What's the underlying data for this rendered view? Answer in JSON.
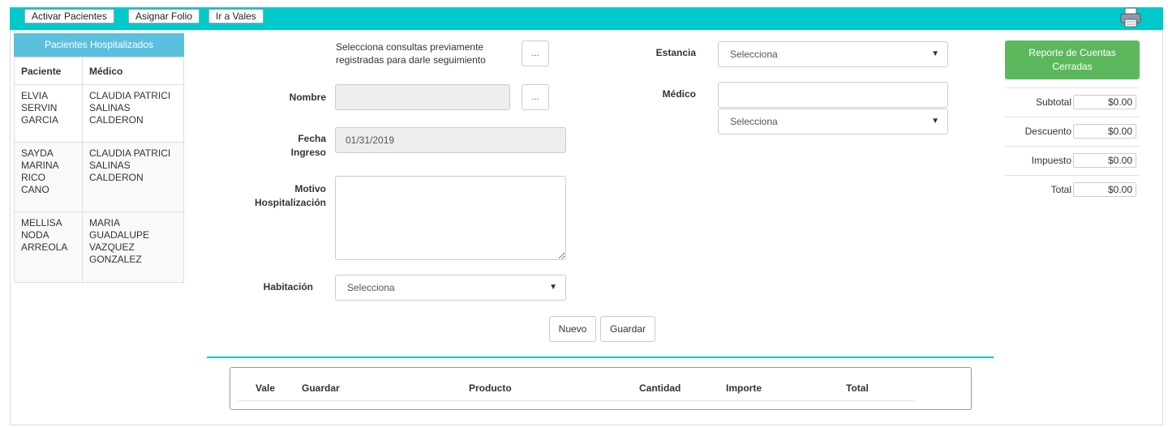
{
  "toolbar": {
    "activar_label": "Activar Pacientes",
    "asignar_label": "Asignar Folio",
    "vales_label": "Ir a Vales"
  },
  "patients": {
    "header": "Pacientes Hospitalizados",
    "columns": [
      "Paciente",
      "Médico"
    ],
    "rows": [
      {
        "paciente": "ELVIA SERVIN GARCIA",
        "medico": "CLAUDIA PATRICI SALINAS CALDERON"
      },
      {
        "paciente": "SAYDA MARINA RICO CANO",
        "medico": "CLAUDIA PATRICI SALINAS CALDERON"
      },
      {
        "paciente": "MELLISA NODA ARREOLA",
        "medico": "MARIA GUADALUPE VAZQUEZ GONZALEZ"
      }
    ]
  },
  "form": {
    "hint": "Selecciona consultas previamente registradas para darle seguimiento",
    "dots_label": "...",
    "nombre_label": "Nombre",
    "nombre_value": "",
    "fecha_label_1": "Fecha",
    "fecha_label_2": "Ingreso",
    "fecha_value": "01/31/2019",
    "motivo_label_1": "Motivo",
    "motivo_label_2": "Hospitalización",
    "motivo_value": "",
    "habitacion_label": "Habitación",
    "habitacion_value": "Selecciona",
    "estancia_label": "Estancia",
    "estancia_value": "Selecciona",
    "medico_label": "Médico",
    "medico_value": "",
    "medico_select_value": "Selecciona",
    "nuevo_label": "Nuevo",
    "guardar_label": "Guardar"
  },
  "report": {
    "button_label_1": "Reporte de Cuentas",
    "button_label_2": "Cerradas"
  },
  "totals": [
    {
      "label": "Subtotal",
      "value": "$0.00"
    },
    {
      "label": "Descuento",
      "value": "$0.00"
    },
    {
      "label": "Impuesto",
      "value": "$0.00"
    },
    {
      "label": "Total",
      "value": "$0.00"
    }
  ],
  "grid": {
    "columns": [
      "Vale",
      "Guardar",
      "Producto",
      "Cantidad",
      "Importe",
      "Total"
    ]
  },
  "colors": {
    "accent": "#00c9cc",
    "patients_header": "#5bc0de",
    "report_button": "#5cb85c"
  },
  "icons": {
    "print": "printer-icon",
    "select_arrow": "▼"
  }
}
